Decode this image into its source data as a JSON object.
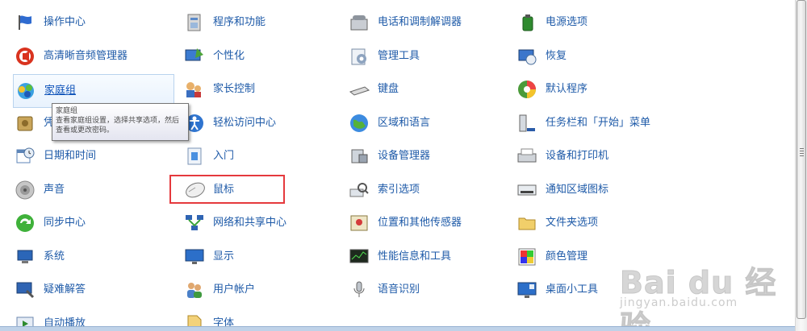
{
  "columns": [
    {
      "items": [
        {
          "name": "action-center",
          "icon": "flag-icon",
          "label": "操作中心"
        },
        {
          "name": "realtek-audio",
          "icon": "speaker-icon",
          "label": "高清晰音频管理器"
        },
        {
          "name": "homegroup",
          "icon": "homegroup-icon",
          "label": "家庭组",
          "hover": true
        },
        {
          "name": "credential",
          "icon": "vault-icon",
          "label": "凭据管理器"
        },
        {
          "name": "date-time",
          "icon": "calendar-clock-icon",
          "label": "日期和时间"
        },
        {
          "name": "sound",
          "icon": "sound-icon",
          "label": "声音"
        },
        {
          "name": "sync-center",
          "icon": "sync-icon",
          "label": "同步中心"
        },
        {
          "name": "system",
          "icon": "system-icon",
          "label": "系统"
        },
        {
          "name": "troubleshooting",
          "icon": "troubleshoot-icon",
          "label": "疑难解答"
        },
        {
          "name": "autoplay",
          "icon": "autoplay-icon",
          "label": "自动播放"
        }
      ]
    },
    {
      "items": [
        {
          "name": "programs",
          "icon": "programs-icon",
          "label": "程序和功能"
        },
        {
          "name": "personalization",
          "icon": "personalize-icon",
          "label": "个性化"
        },
        {
          "name": "parental",
          "icon": "parental-icon",
          "label": "家长控制"
        },
        {
          "name": "ease-access",
          "icon": "ease-access-icon",
          "label": "轻松访问中心"
        },
        {
          "name": "getting-started",
          "icon": "getting-started-icon",
          "label": "入门"
        },
        {
          "name": "mouse",
          "icon": "mouse-icon",
          "label": "鼠标"
        },
        {
          "name": "network",
          "icon": "network-icon",
          "label": "网络和共享中心"
        },
        {
          "name": "display",
          "icon": "display-icon",
          "label": "显示"
        },
        {
          "name": "user-accounts",
          "icon": "users-icon",
          "label": "用户帐户"
        },
        {
          "name": "fonts",
          "icon": "fonts-icon",
          "label": "字体"
        }
      ]
    },
    {
      "items": [
        {
          "name": "phone-modem",
          "icon": "phone-icon",
          "label": "电话和调制解调器"
        },
        {
          "name": "admin-tools",
          "icon": "admin-tools-icon",
          "label": "管理工具"
        },
        {
          "name": "keyboard",
          "icon": "keyboard-icon",
          "label": "键盘"
        },
        {
          "name": "region-language",
          "icon": "globe-icon",
          "label": "区域和语言"
        },
        {
          "name": "device-manager",
          "icon": "device-manager-icon",
          "label": "设备管理器"
        },
        {
          "name": "indexing",
          "icon": "index-icon",
          "label": "索引选项"
        },
        {
          "name": "location",
          "icon": "location-icon",
          "label": "位置和其他传感器"
        },
        {
          "name": "performance",
          "icon": "performance-icon",
          "label": "性能信息和工具"
        },
        {
          "name": "speech",
          "icon": "microphone-icon",
          "label": "语音识别"
        }
      ]
    },
    {
      "items": [
        {
          "name": "power",
          "icon": "power-icon",
          "label": "电源选项"
        },
        {
          "name": "recovery",
          "icon": "recovery-icon",
          "label": "恢复"
        },
        {
          "name": "default-programs",
          "icon": "default-programs-icon",
          "label": "默认程序"
        },
        {
          "name": "taskbar",
          "icon": "taskbar-icon",
          "label": "任务栏和「开始」菜单"
        },
        {
          "name": "devices-printers",
          "icon": "printer-icon",
          "label": "设备和打印机"
        },
        {
          "name": "notification-icons",
          "icon": "notification-icon",
          "label": "通知区域图标"
        },
        {
          "name": "folder-options",
          "icon": "folder-icon",
          "label": "文件夹选项"
        },
        {
          "name": "color-management",
          "icon": "color-icon",
          "label": "颜色管理"
        },
        {
          "name": "gadgets",
          "icon": "gadgets-icon",
          "label": "桌面小工具"
        }
      ]
    }
  ],
  "tooltip": {
    "title": "家庭组",
    "body": "查看家庭组设置，选择共享选项，然后查看或更改密码。"
  },
  "watermark": {
    "text": "Bai du 经验",
    "url": "jingyan.baidu.com"
  },
  "colors": {
    "link": "#1e5aa8",
    "highlight": "#e5393d"
  }
}
